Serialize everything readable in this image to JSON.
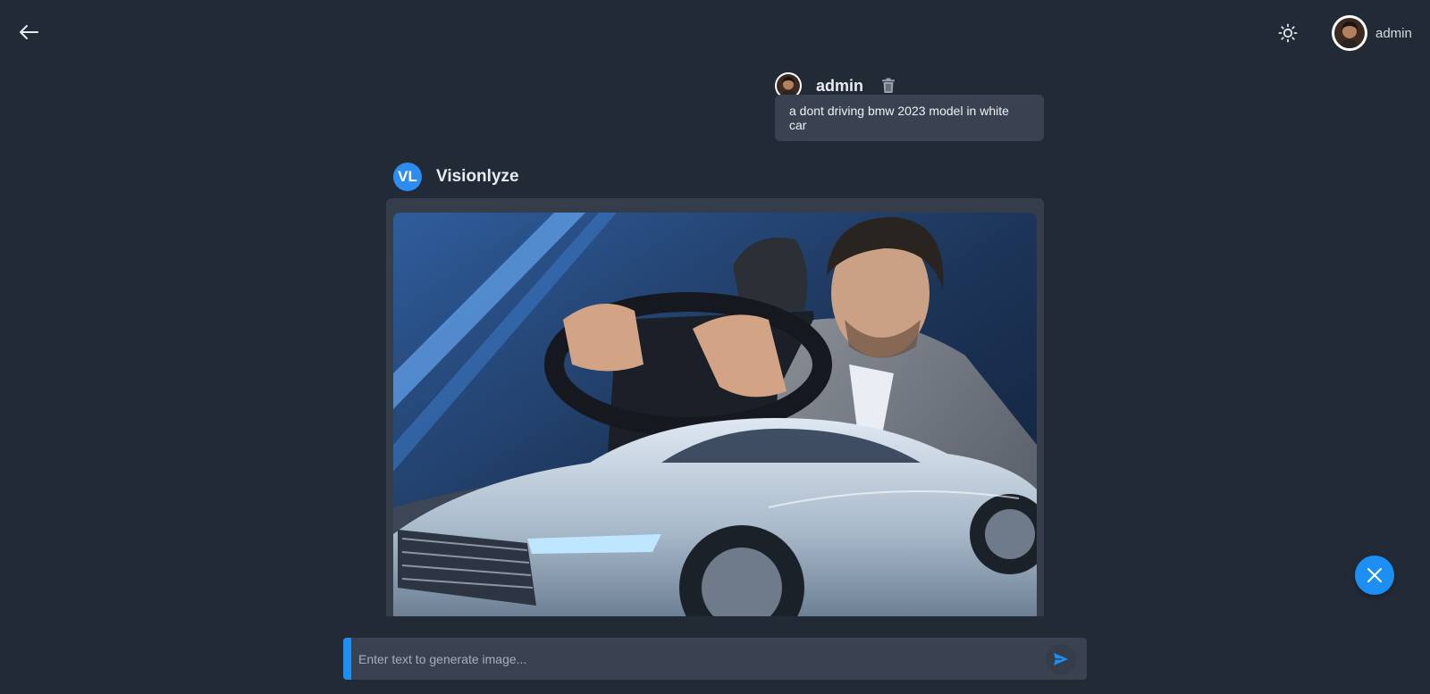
{
  "header": {
    "back_icon": "arrow-left-icon",
    "theme_icon": "sun-icon",
    "user": {
      "name": "admin",
      "avatar_icon": "user-avatar"
    }
  },
  "conversation": {
    "user_message": {
      "author": "admin",
      "text": "a dont driving bmw 2023 model in white car",
      "delete_icon": "trash-icon"
    },
    "bot_message": {
      "avatar_initials": "VL",
      "author": "Visionlyze",
      "image_description": "generated image"
    }
  },
  "composer": {
    "placeholder": "Enter text to generate image...",
    "send_icon": "send-icon"
  },
  "close_icon": "close-icon",
  "colors": {
    "background": "#222a36",
    "bubble": "#3a4251",
    "card": "#353d4b",
    "accent": "#1e8ff2",
    "bot_avatar": "#2d8cf0"
  }
}
